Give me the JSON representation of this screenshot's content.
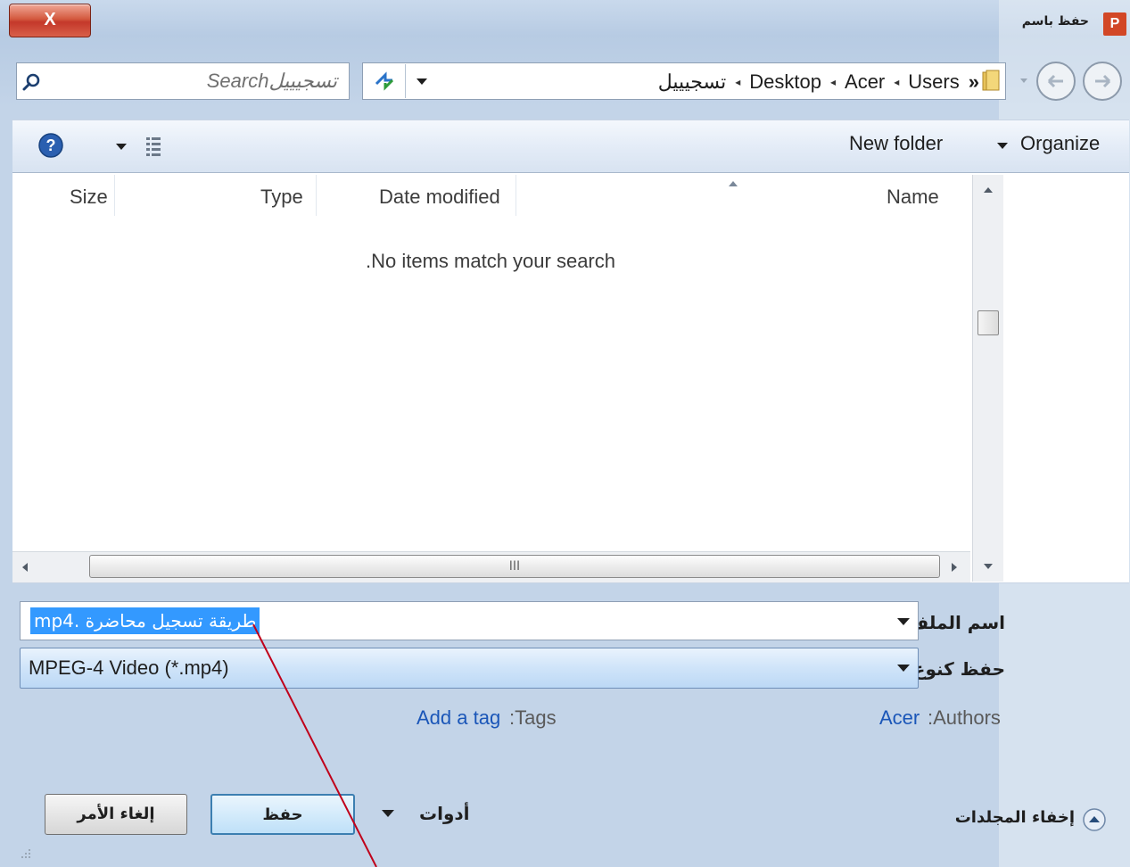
{
  "window": {
    "title": "حفظ باسم",
    "close_label": "X",
    "app_icon_label": "P"
  },
  "address_bar": {
    "overflow": "»",
    "breadcrumbs": [
      "Users",
      "Acer",
      "Desktop",
      "تسجيييل"
    ],
    "separator": "◂"
  },
  "search": {
    "placeholder": "Searchتسجيييل"
  },
  "toolbar": {
    "organize_label": "Organize",
    "new_folder_label": "New folder"
  },
  "file_list": {
    "columns": [
      "Name",
      "Date modified",
      "Type",
      "Size"
    ],
    "empty_message": ".No items match your search"
  },
  "form": {
    "filename_label": "اسم الملف:",
    "filename_value": "طريقة تسجيل محاضرة .mp4",
    "savetype_label": "حفظ كنوع:",
    "savetype_value": "MPEG-4 Video (*.mp4)",
    "authors_label": ":Authors",
    "authors_value": "Acer",
    "tags_label": ":Tags",
    "tags_value": "Add a tag"
  },
  "buttons": {
    "hide_folders": "إخفاء المجلدات",
    "tools": "أدوات",
    "save": "حفظ",
    "cancel": "إلغاء الأمر"
  },
  "scrollbar": {
    "h_grip": "III"
  },
  "colors": {
    "selection": "#3399ff",
    "annotation_line": "#c0001a",
    "link": "#1a56b8"
  }
}
